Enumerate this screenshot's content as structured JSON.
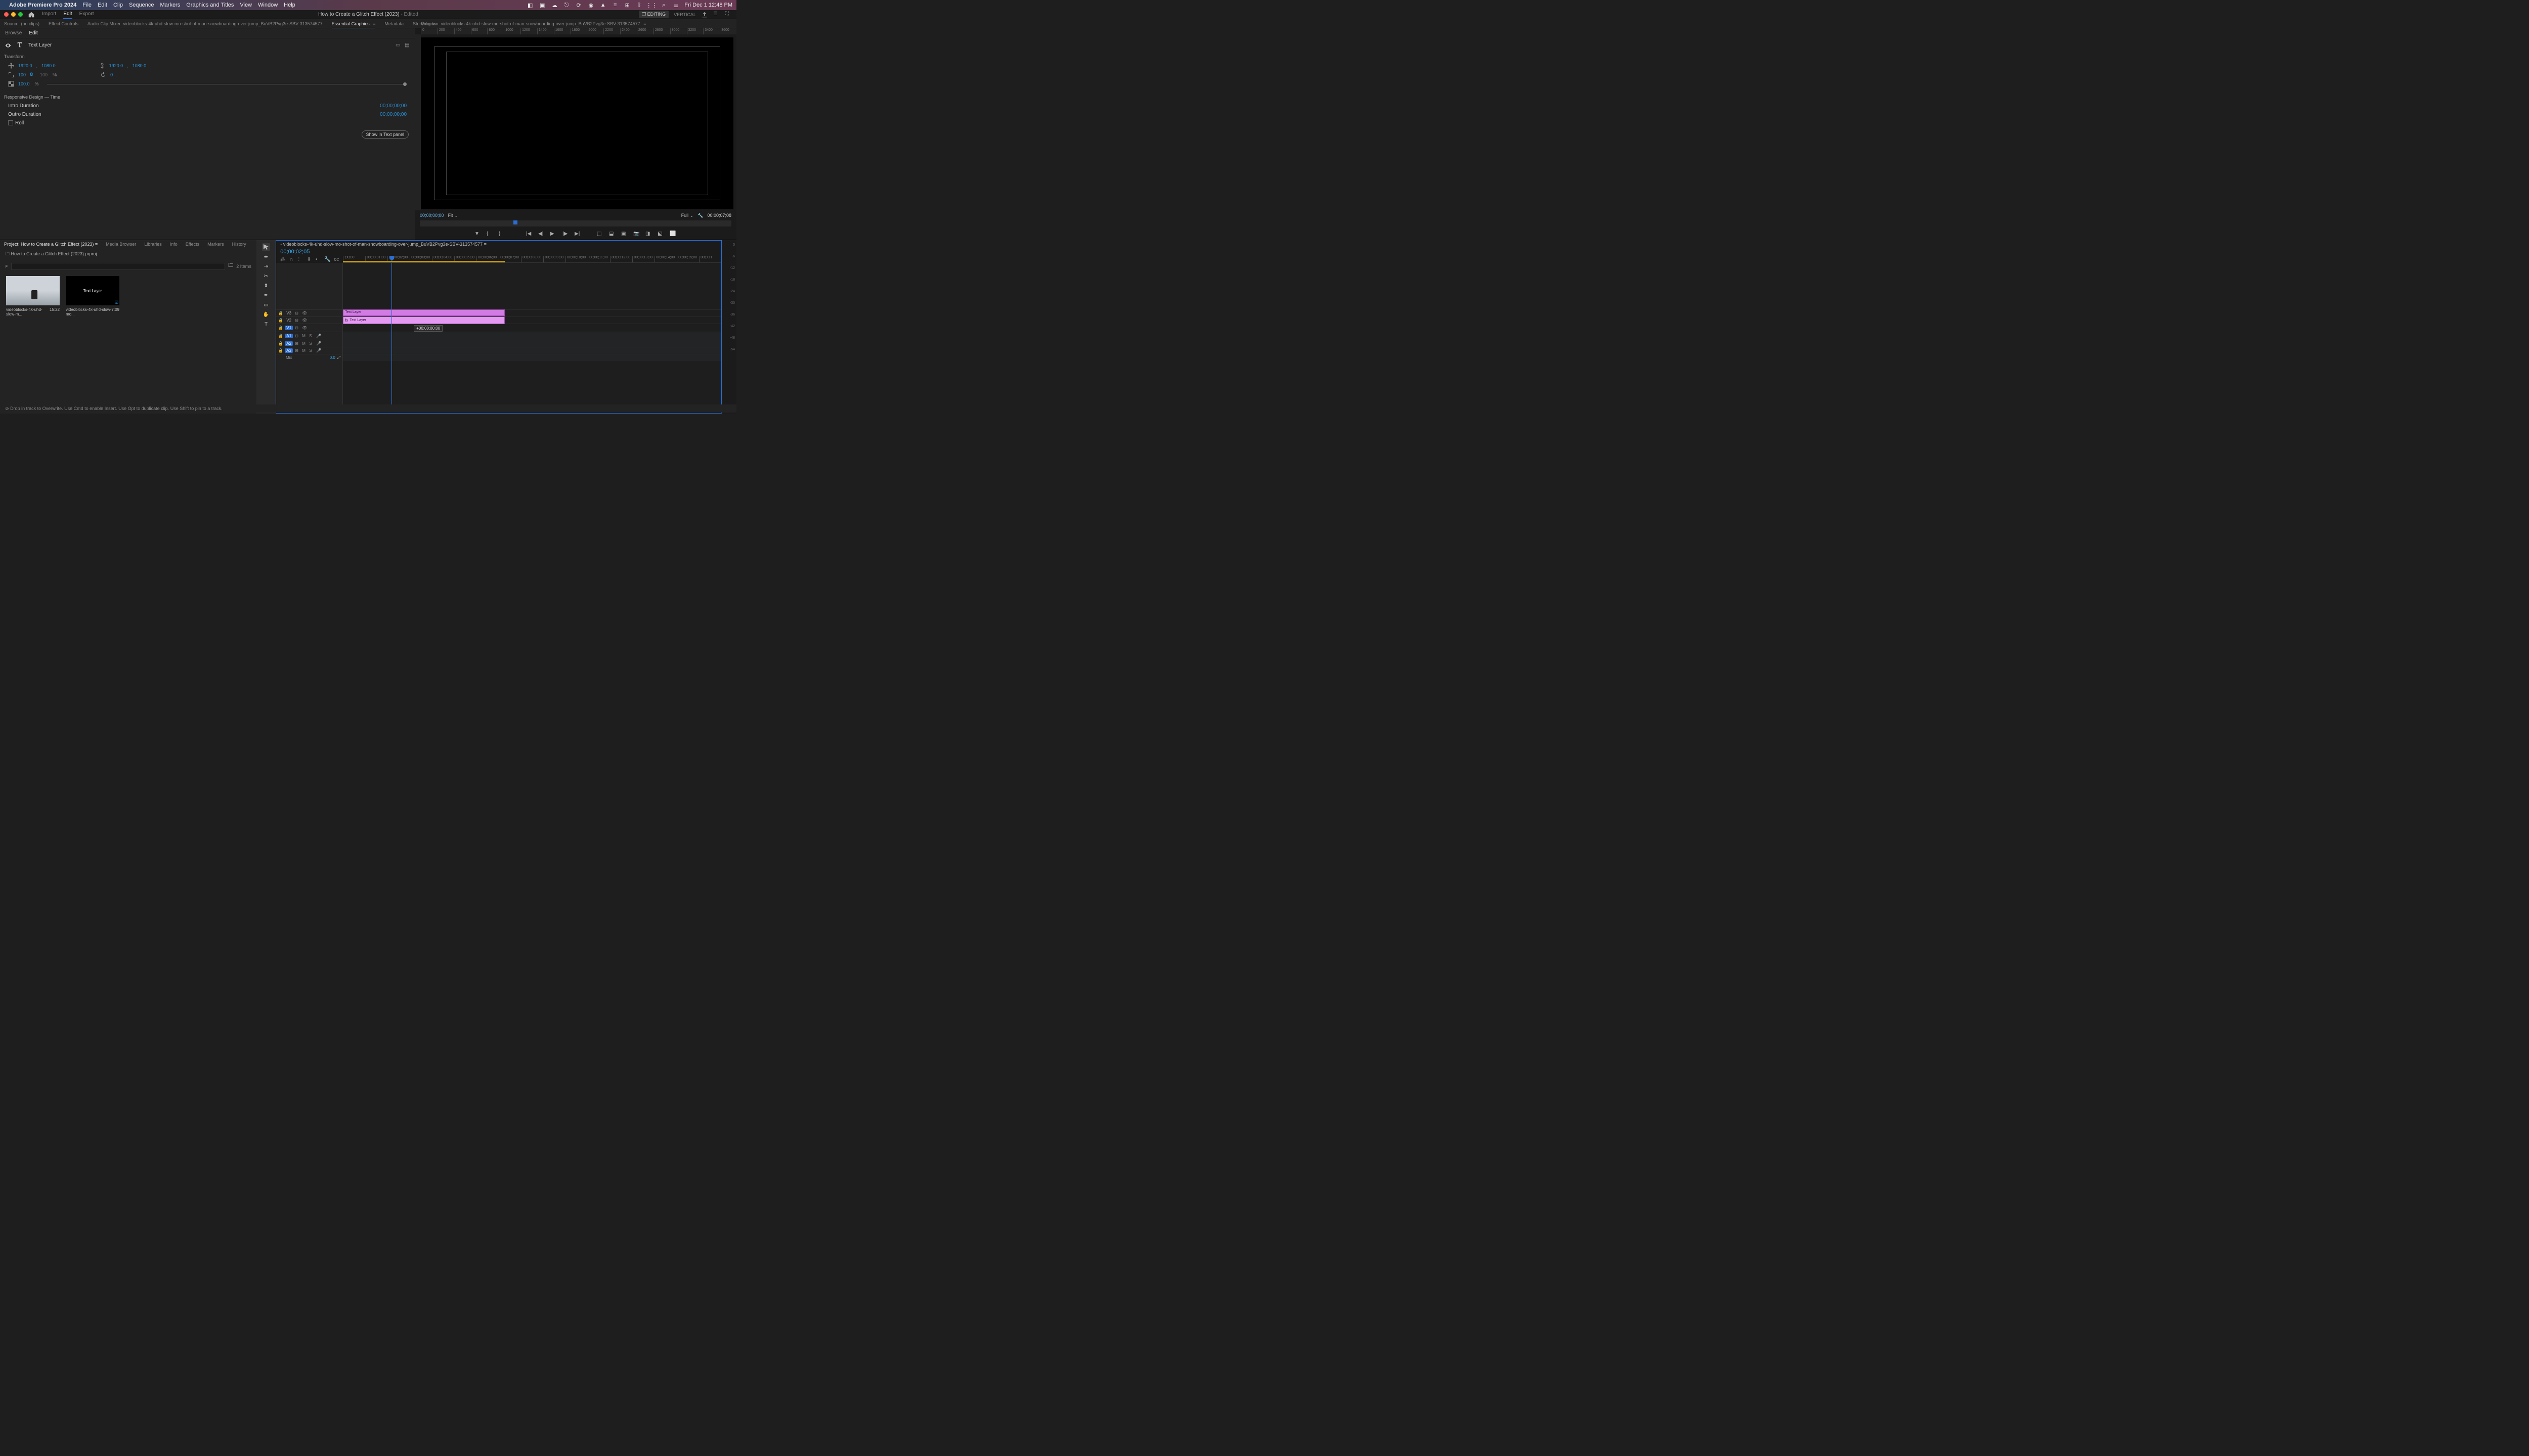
{
  "menubar": {
    "app": "Adobe Premiere Pro 2024",
    "items": [
      "File",
      "Edit",
      "Clip",
      "Sequence",
      "Markers",
      "Graphics and Titles",
      "View",
      "Window",
      "Help"
    ],
    "datetime": "Fri Dec 1  12:48 PM"
  },
  "header": {
    "tabs": [
      "Import",
      "Edit",
      "Export"
    ],
    "active_tab": "Edit",
    "doc_title": "How to Create a Glitch Effect (2023)",
    "doc_status": "Edited",
    "workspace": "EDITING",
    "vertical": "VERTICAL"
  },
  "subtabs": {
    "items": [
      "Source: (no clips)",
      "Effect Controls",
      "Audio Clip Mixer: videoblocks-4k-uhd-slow-mo-shot-of-man-snowboarding-over-jump_BuVB2Pvg3e-SBV-313574577",
      "Essential Graphics",
      "Metadata",
      "Storyblocks"
    ],
    "active": "Essential Graphics"
  },
  "eg_panel": {
    "tabs": [
      "Browse",
      "Edit"
    ],
    "active": "Edit",
    "layer": "Text Layer",
    "transform_label": "Transform",
    "pos": {
      "x": "1920.0",
      "y": "1080.0"
    },
    "anchor": {
      "x": "1920.0",
      "y": "1080.0"
    },
    "scale": {
      "w": "100",
      "h": "100",
      "unit": "%"
    },
    "rotation": "0",
    "opacity": "100.0",
    "opacity_unit": "%",
    "rd_label": "Responsive Design — Time",
    "intro": "Intro Duration",
    "intro_tc": "00;00;00;00",
    "outro": "Outro Duration",
    "outro_tc": "00;00;00;00",
    "roll": "Roll",
    "show_btn": "Show in Text panel"
  },
  "program": {
    "title": "Program: videoblocks-4k-uhd-slow-mo-shot-of-man-snowboarding-over-jump_BuVB2Pvg3e-SBV-313574577",
    "ruler_h": [
      "0",
      "200",
      "400",
      "600",
      "800",
      "1000",
      "1200",
      "1400",
      "1600",
      "1800",
      "2000",
      "2200",
      "2400",
      "2600",
      "2800",
      "3000",
      "3200",
      "3400",
      "3600"
    ],
    "tc_left": "00;00;00;00",
    "fit": "Fit",
    "quality": "Full",
    "tc_right": "00;00;07;08"
  },
  "project": {
    "tabs": [
      "Project: How to Create a Glitch Effect (2023)",
      "Media Browser",
      "Libraries",
      "Info",
      "Effects",
      "Markers",
      "History"
    ],
    "active": 0,
    "bin": "How to Create a Glitch Effect (2023).prproj",
    "items_count": "2 Items",
    "thumb1": {
      "name": "videoblocks-4k-uhd-slow-m...",
      "dur": "15:22"
    },
    "thumb2": {
      "name": "videoblocks-4k-uhd-slow-mo...",
      "dur": "7:09",
      "text": "Text Layer"
    }
  },
  "timeline": {
    "seq": "videoblocks-4k-uhd-slow-mo-shot-of-man-snowboarding-over-jump_BuVB2Pvg3e-SBV-313574577",
    "tc": "00;00;02;05",
    "ruler": [
      ";00;00",
      "00;00;01;00",
      "00;00;02;00",
      "00;00;03;00",
      "00;00;04;00",
      "00;00;05;00",
      "00;00;06;00",
      "00;00;07;00",
      "00;00;08;00",
      "00;00;09;00",
      "00;00;10;00",
      "00;00;11;00",
      "00;00;12;00",
      "00;00;13;00",
      "00;00;14;00",
      "00;00;15;00",
      "00;00;1"
    ],
    "tracks_v": [
      "V3",
      "V2",
      "V1"
    ],
    "tracks_a": [
      "A1",
      "A2",
      "A3"
    ],
    "mix": "Mix",
    "mix_db": "0.0",
    "clip1": "Text Layer",
    "clip2": "Text Layer",
    "clip2_fx": "fx",
    "drag_offset": "+00;00;00;00"
  },
  "meter_ticks": [
    "0",
    "-6",
    "-12",
    "-18",
    "-24",
    "-30",
    "-36",
    "-42",
    "-48",
    "-54"
  ],
  "status": "Drop in track to Overwrite. Use Cmd to enable Insert. Use Opt to duplicate clip. Use Shift to pin to a track."
}
